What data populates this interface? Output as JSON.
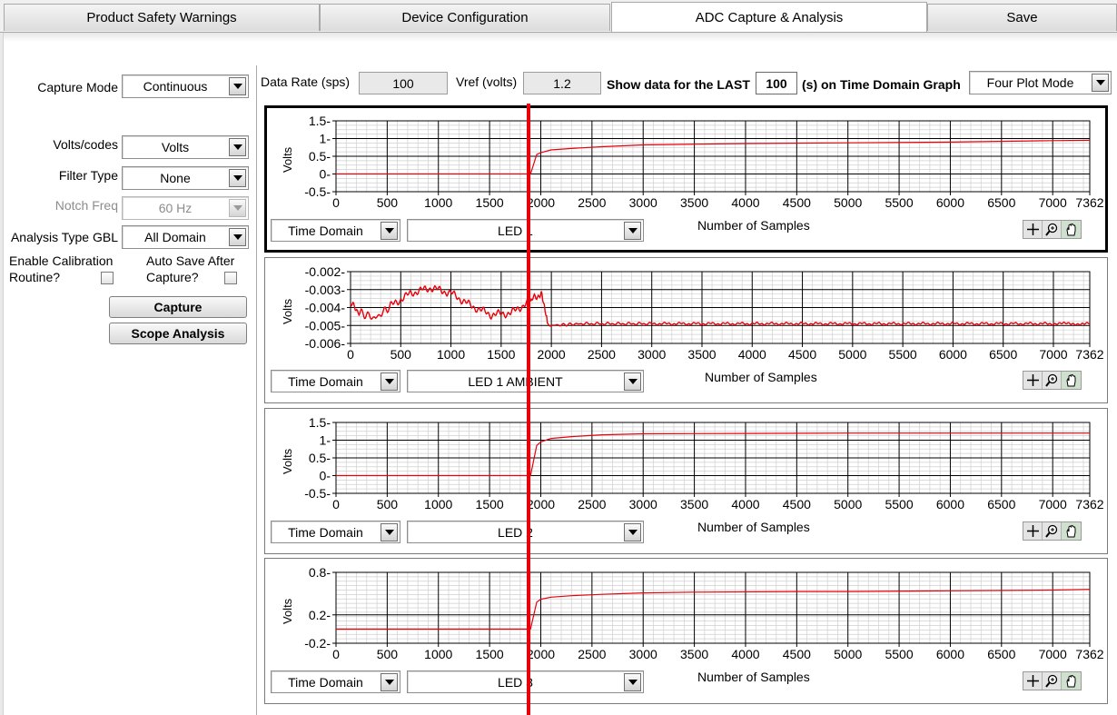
{
  "tabs": [
    {
      "label": "Product Safety Warnings",
      "active": false
    },
    {
      "label": "Device Configuration",
      "active": false
    },
    {
      "label": "ADC Capture & Analysis",
      "active": true
    },
    {
      "label": "Save",
      "active": false
    }
  ],
  "left_panel": {
    "capture_mode_label": "Capture Mode",
    "capture_mode_value": "Continuous",
    "volts_codes_label": "Volts/codes",
    "volts_codes_value": "Volts",
    "filter_type_label": "Filter Type",
    "filter_type_value": "None",
    "notch_freq_label": "Notch Freq",
    "notch_freq_value": "60 Hz",
    "analysis_type_label": "Analysis Type GBL",
    "analysis_type_value": "All Domain",
    "enable_calibration_label_1": "Enable Calibration",
    "enable_calibration_label_2": "Routine?",
    "enable_calibration_checked": false,
    "auto_save_label_1": "Auto Save After",
    "auto_save_label_2": "Capture?",
    "auto_save_checked": false,
    "capture_button": "Capture",
    "scope_analysis_button": "Scope Analysis"
  },
  "top_bar": {
    "data_rate_label": "Data Rate (sps)",
    "data_rate_value": "100",
    "vref_label": "Vref (volts)",
    "vref_value": "1.2",
    "show_last_label": "Show data for the LAST",
    "show_last_value": "100",
    "show_last_suffix": "(s) on Time Domain Graph",
    "plot_mode_value": "Four Plot Mode"
  },
  "colors": {
    "trace": "#e8000b",
    "cursor": "#e8000b",
    "grid_major": "#000000",
    "grid_minor": "#cfcfcf"
  },
  "graph_common": {
    "x_axis_label": "Number of Samples",
    "y_axis_label": "Volts",
    "domain_value": "Time Domain",
    "tool_icons": [
      "crosshair-icon",
      "zoom-icon",
      "pan-hand-icon"
    ]
  },
  "chart_data": [
    {
      "type": "line",
      "series_label": "LED 1",
      "xlabel": "Number of Samples",
      "ylabel": "Volts",
      "xlim": [
        0,
        7362
      ],
      "ylim": [
        -0.5,
        1.5
      ],
      "xticks": [
        "0",
        "500",
        "1000",
        "1500",
        "2000",
        "2500",
        "3000",
        "3500",
        "4000",
        "4500",
        "5000",
        "5500",
        "6000",
        "6500",
        "7000",
        "7362"
      ],
      "yticks": [
        "1.5",
        "1",
        "0.5",
        "0",
        "-0.5"
      ],
      "x": [
        0,
        1900,
        1960,
        2000,
        2100,
        2300,
        2600,
        3000,
        3500,
        4000,
        5000,
        6000,
        7000,
        7362
      ],
      "values": [
        0.0,
        0.0,
        0.55,
        0.6,
        0.68,
        0.72,
        0.77,
        0.82,
        0.84,
        0.86,
        0.88,
        0.9,
        0.94,
        0.95
      ]
    },
    {
      "type": "line",
      "series_label": "LED 1 AMBIENT",
      "xlabel": "Number of Samples",
      "ylabel": "Volts",
      "xlim": [
        0,
        7362
      ],
      "ylim": [
        -0.006,
        -0.002
      ],
      "xticks": [
        "0",
        "500",
        "1000",
        "1500",
        "2000",
        "2500",
        "3000",
        "3500",
        "4000",
        "4500",
        "5000",
        "5500",
        "6000",
        "6500",
        "7000",
        "7362"
      ],
      "yticks": [
        "-0.002",
        "-0.003",
        "-0.004",
        "-0.005",
        "-0.006"
      ],
      "x": [
        0,
        100,
        250,
        400,
        600,
        800,
        1000,
        1200,
        1400,
        1600,
        1800,
        1900,
        1960,
        2000,
        2300,
        3000,
        4000,
        5000,
        6000,
        7000,
        7362
      ],
      "values": [
        -0.0038,
        -0.0043,
        -0.0046,
        -0.0039,
        -0.0032,
        -0.0029,
        -0.0032,
        -0.0039,
        -0.0044,
        -0.0043,
        -0.0036,
        -0.0032,
        -0.0049,
        -0.005,
        -0.0049,
        -0.0049,
        -0.0049,
        -0.0049,
        -0.0049,
        -0.0049,
        -0.0049
      ]
    },
    {
      "type": "line",
      "series_label": "LED 2",
      "xlabel": "Number of Samples",
      "ylabel": "Volts",
      "xlim": [
        0,
        7362
      ],
      "ylim": [
        -0.5,
        1.5
      ],
      "xticks": [
        "0",
        "500",
        "1000",
        "1500",
        "2000",
        "2500",
        "3000",
        "3500",
        "4000",
        "4500",
        "5000",
        "5500",
        "6000",
        "6500",
        "7000",
        "7362"
      ],
      "yticks": [
        "1.5",
        "1",
        "0.5",
        "0",
        "-0.5"
      ],
      "x": [
        0,
        1900,
        1960,
        2000,
        2100,
        2300,
        2600,
        3000,
        4000,
        5000,
        6000,
        7000,
        7362
      ],
      "values": [
        0.0,
        0.0,
        0.85,
        0.95,
        1.05,
        1.1,
        1.15,
        1.18,
        1.19,
        1.2,
        1.2,
        1.2,
        1.2
      ]
    },
    {
      "type": "line",
      "series_label": "LED 3",
      "xlabel": "Number of Samples",
      "ylabel": "Volts",
      "xlim": [
        0,
        7362
      ],
      "ylim": [
        -0.2,
        0.8
      ],
      "xticks": [
        "0",
        "500",
        "1000",
        "1500",
        "2000",
        "2500",
        "3000",
        "3500",
        "4000",
        "4500",
        "5000",
        "5500",
        "6000",
        "6500",
        "7000",
        "7362"
      ],
      "yticks": [
        "0.8",
        "0.2",
        "-0.2"
      ],
      "x": [
        0,
        1900,
        1960,
        2000,
        2100,
        2300,
        2600,
        3000,
        3500,
        4500,
        5000,
        6000,
        7000,
        7362
      ],
      "values": [
        0.0,
        0.0,
        0.38,
        0.42,
        0.45,
        0.47,
        0.49,
        0.51,
        0.52,
        0.53,
        0.53,
        0.54,
        0.55,
        0.56
      ]
    }
  ]
}
